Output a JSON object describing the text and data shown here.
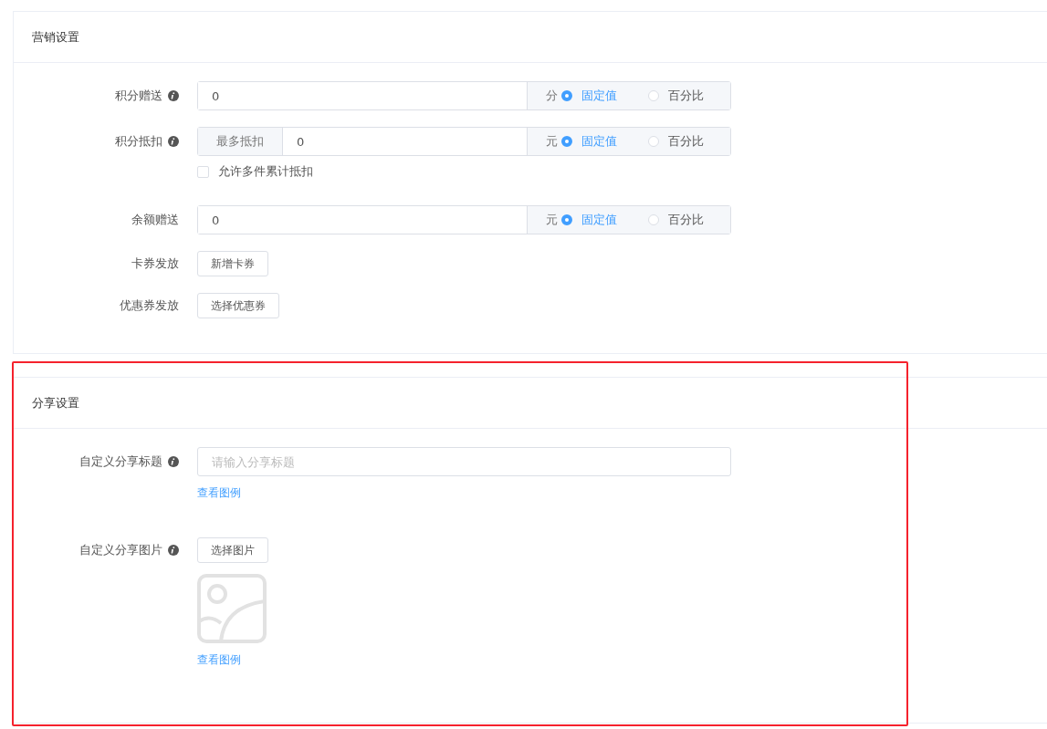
{
  "sections": [
    {
      "title": "营销设置",
      "highlighted": false,
      "fields": [
        {
          "kind": "unit_input",
          "label": "积分赠送",
          "info": true,
          "value": "0",
          "unit": "分",
          "options": [
            {
              "label": "固定值",
              "selected": true
            },
            {
              "label": "百分比",
              "selected": false
            }
          ]
        },
        {
          "kind": "unit_input",
          "label": "积分抵扣",
          "info": true,
          "prefix": "最多抵扣",
          "value": "0",
          "unit": "元",
          "options": [
            {
              "label": "固定值",
              "selected": true
            },
            {
              "label": "百分比",
              "selected": false
            }
          ],
          "checkbox": {
            "label": "允许多件累计抵扣",
            "checked": false
          }
        },
        {
          "kind": "unit_input",
          "label": "余额赠送",
          "info": false,
          "value": "0",
          "unit": "元",
          "options": [
            {
              "label": "固定值",
              "selected": true
            },
            {
              "label": "百分比",
              "selected": false
            }
          ]
        },
        {
          "kind": "button",
          "label": "卡券发放",
          "info": false,
          "button": "新增卡券"
        },
        {
          "kind": "button",
          "label": "优惠券发放",
          "info": false,
          "button": "选择优惠券"
        }
      ]
    },
    {
      "title": "分享设置",
      "highlighted": true,
      "fields": [
        {
          "kind": "text_input",
          "label": "自定义分享标题",
          "info": true,
          "placeholder": "请输入分享标题",
          "link": "查看图例"
        },
        {
          "kind": "image",
          "label": "自定义分享图片",
          "info": true,
          "button": "选择图片",
          "link": "查看图例"
        }
      ]
    }
  ]
}
